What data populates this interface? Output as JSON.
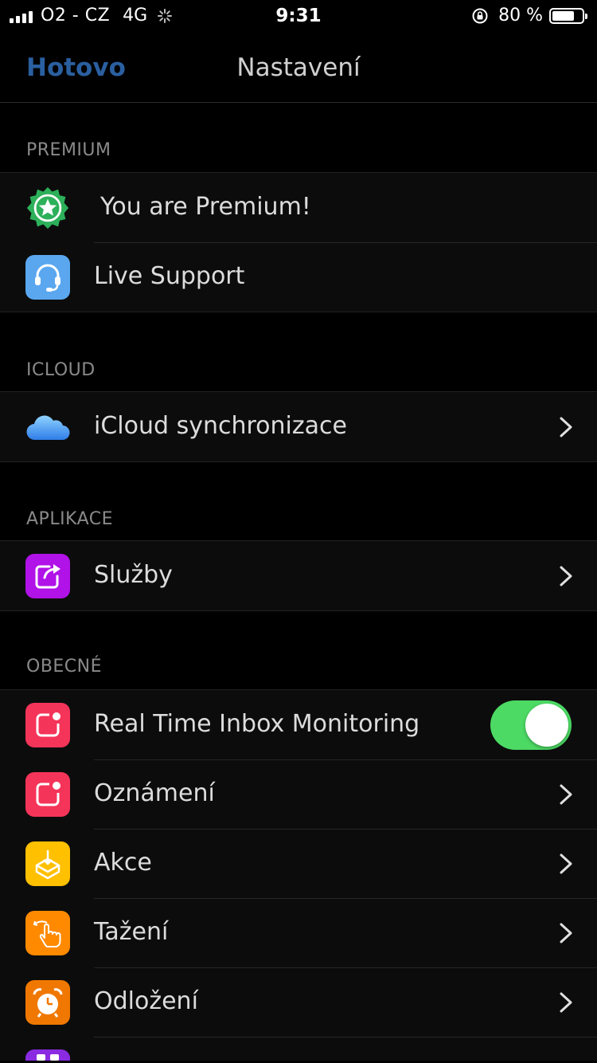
{
  "status_bar": {
    "carrier": "O2 - CZ",
    "network": "4G",
    "time": "9:31",
    "battery_pct": "80 %",
    "battery_level": 0.8
  },
  "nav": {
    "done_label": "Hotovo",
    "title": "Nastavení"
  },
  "sections": {
    "premium": {
      "header": "PREMIUM",
      "you_are_premium": "You are Premium!",
      "live_support": "Live Support"
    },
    "icloud": {
      "header": "ICLOUD",
      "sync": "iCloud synchronizace"
    },
    "aplikace": {
      "header": "APLIKACE",
      "services": "Služby"
    },
    "obecne": {
      "header": "OBECNÉ",
      "realtime": "Real Time Inbox Monitoring",
      "realtime_on": true,
      "notifications": "Oznámení",
      "actions": "Akce",
      "swipes": "Tažení",
      "snooze": "Odložení"
    }
  },
  "colors": {
    "accent": "#2a5fa0",
    "toggle_on": "#4cd964",
    "premium_badge": "#2db05a",
    "support_icon": "#5aa7f0",
    "services_icon": "#b012e8",
    "red_icon": "#f5345a",
    "actions_icon": "#ffc000",
    "swipes_icon": "#ff8a00",
    "snooze_icon": "#f07800"
  },
  "icons": {
    "premium": "star-badge-icon",
    "support": "headset-icon",
    "icloud": "cloud-icon",
    "services": "share-icon",
    "realtime": "notification-badge-icon",
    "notifications": "notification-badge-icon",
    "actions": "box-download-icon",
    "swipes": "swipe-hand-icon",
    "snooze": "alarm-clock-icon"
  }
}
